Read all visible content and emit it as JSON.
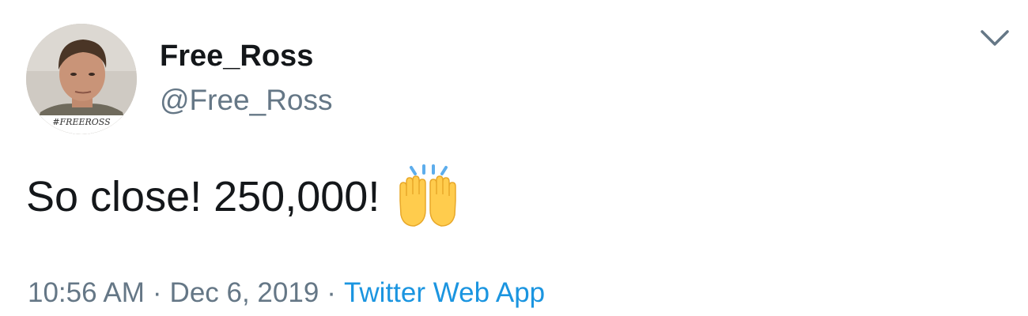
{
  "user": {
    "display_name": "Free_Ross",
    "handle": "@Free_Ross",
    "avatar_caption": "#FREEROSS"
  },
  "tweet": {
    "text": "So close! 250,000!",
    "emoji": "raising-hands"
  },
  "meta": {
    "time": "10:56 AM",
    "separator": "·",
    "date": "Dec 6, 2019",
    "source": "Twitter Web App"
  },
  "icons": {
    "menu": "chevron-down-icon"
  },
  "colors": {
    "text_primary": "#14171a",
    "text_secondary": "#657786",
    "link": "#1b95e0",
    "emoji_yellow": "#ffcc4d",
    "emoji_spark": "#5dadec"
  }
}
